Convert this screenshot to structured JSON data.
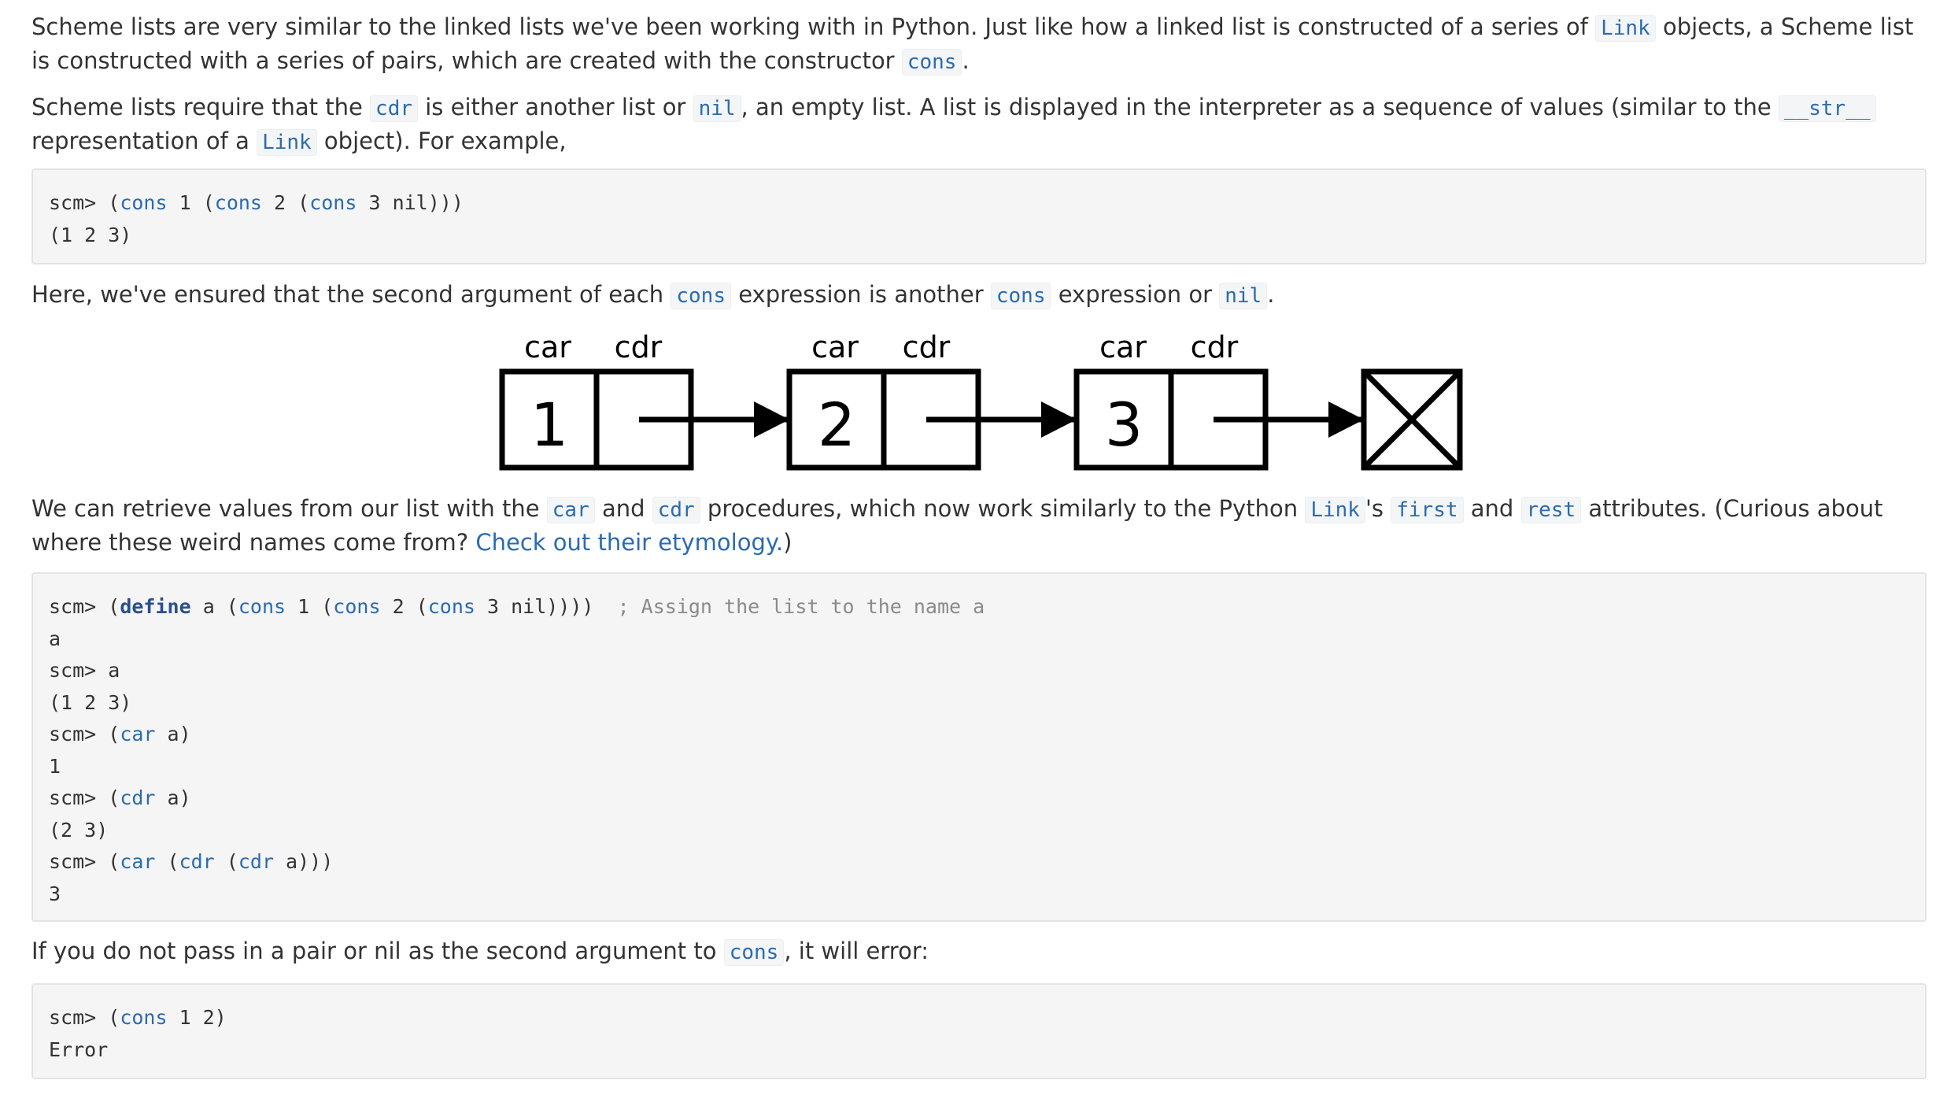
{
  "para1": {
    "t1": "Scheme lists are very similar to the linked lists we've been working with in Python. Just like how a linked list is constructed of a series of ",
    "c1": "Link",
    "t2": " objects, a Scheme list is constructed with a series of pairs, which are created with the constructor ",
    "c2": "cons",
    "t3": "."
  },
  "para2": {
    "t1": "Scheme lists require that the ",
    "c1": "cdr",
    "t2": " is either another list or ",
    "c2": "nil",
    "t3": ", an empty list. A list is displayed in the interpreter as a sequence of values (similar to the ",
    "c3": "__str__",
    "t4": " representation of a ",
    "c4": "Link",
    "t5": " object). For example,"
  },
  "block1": {
    "lines": [
      {
        "prompt": "scm> ",
        "open": "(",
        "fn1": "cons",
        "a1": " 1 (",
        "fn2": "cons",
        "a2": " 2 (",
        "fn3": "cons",
        "a3": " 3 nil)))"
      },
      {
        "text": "(1 2 3)"
      }
    ]
  },
  "para3": {
    "t1": "Here, we've ensured that the second argument of each ",
    "c1": "cons",
    "t2": " expression is another ",
    "c2": "cons",
    "t3": " expression or ",
    "c3": "nil",
    "t4": "."
  },
  "diagram": {
    "car_label": "car",
    "cdr_label": "cdr",
    "values": [
      "1",
      "2",
      "3"
    ]
  },
  "para4": {
    "t1": "We can retrieve values from our list with the ",
    "c1": "car",
    "t2": " and ",
    "c2": "cdr",
    "t3": " procedures, which now work similarly to the Python ",
    "c3": "Link",
    "t4": "'s ",
    "c4": "first",
    "t5": " and ",
    "c5": "rest",
    "t6": " attributes. (Curious about where these weird names come from? ",
    "link": "Check out their etymology.",
    "t7": ")"
  },
  "block2": {
    "l1": {
      "prompt": "scm> ",
      "kw": "define",
      "a1": " a (",
      "fn1": "cons",
      "a2": " 1 (",
      "fn2": "cons",
      "a3": " 2 (",
      "fn3": "cons",
      "a4": " 3 nil))))",
      "comment": "  ; Assign the list to the name a"
    },
    "l2": "a",
    "l3": "scm> a",
    "l4": "(1 2 3)",
    "l5": {
      "prompt": "scm> (",
      "fn": "car",
      "rest": " a)"
    },
    "l6": "1",
    "l7": {
      "prompt": "scm> (",
      "fn": "cdr",
      "rest": " a)"
    },
    "l8": "(2 3)",
    "l9": {
      "prompt": "scm> (",
      "fn1": "car",
      "a1": " (",
      "fn2": "cdr",
      "a2": " (",
      "fn3": "cdr",
      "a3": " a)))"
    },
    "l10": "3"
  },
  "para5": {
    "t1": "If you do not pass in a pair or nil as the second argument to ",
    "c1": "cons",
    "t2": ", it will error:"
  },
  "block3": {
    "l1": {
      "prompt": "scm> (",
      "fn": "cons",
      "rest": " 1 2)"
    },
    "l2": "Error"
  }
}
